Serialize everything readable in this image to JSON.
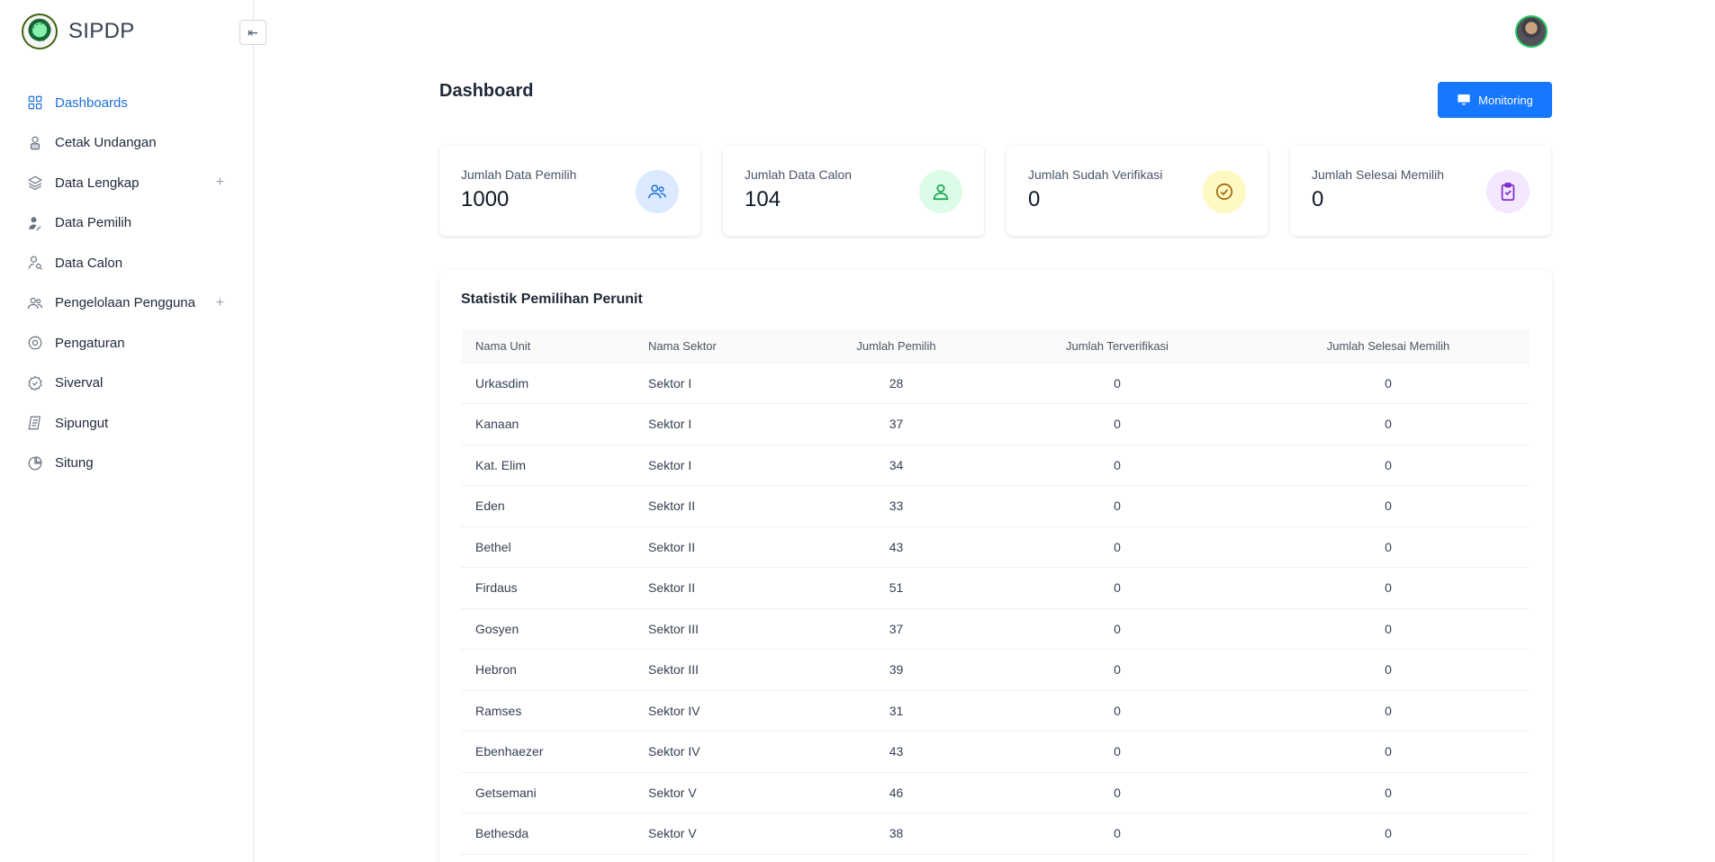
{
  "app": {
    "name": "SIPDP"
  },
  "sidebar": {
    "items": [
      {
        "label": "Dashboards",
        "icon": "grid-icon",
        "active": true,
        "expandable": false
      },
      {
        "label": "Cetak Undangan",
        "icon": "person-card-icon",
        "active": false,
        "expandable": false
      },
      {
        "label": "Data Lengkap",
        "icon": "layers-icon",
        "active": false,
        "expandable": true
      },
      {
        "label": "Data Pemilih",
        "icon": "user-edit-icon",
        "active": false,
        "expandable": false
      },
      {
        "label": "Data Calon",
        "icon": "user-search-icon",
        "active": false,
        "expandable": false
      },
      {
        "label": "Pengelolaan Pengguna",
        "icon": "users-icon",
        "active": false,
        "expandable": true
      },
      {
        "label": "Pengaturan",
        "icon": "settings-icon",
        "active": false,
        "expandable": false
      },
      {
        "label": "Siverval",
        "icon": "check-badge-icon",
        "active": false,
        "expandable": false
      },
      {
        "label": "Sipungut",
        "icon": "scroll-icon",
        "active": false,
        "expandable": false
      },
      {
        "label": "Situng",
        "icon": "pie-chart-icon",
        "active": false,
        "expandable": false
      }
    ]
  },
  "header": {
    "title": "Dashboard",
    "monitoring_label": "Monitoring"
  },
  "cards": [
    {
      "label": "Jumlah Data Pemilih",
      "value": "1000",
      "icon": "users-icon",
      "bg": "#dbeafe",
      "fg": "#1e6fd9"
    },
    {
      "label": "Jumlah Data Calon",
      "value": "104",
      "icon": "user-icon",
      "bg": "#dcfce7",
      "fg": "#16a34a"
    },
    {
      "label": "Jumlah Sudah Verifikasi",
      "value": "0",
      "icon": "check-circle-icon",
      "bg": "#fef9c3",
      "fg": "#a16207"
    },
    {
      "label": "Jumlah Selesai Memilih",
      "value": "0",
      "icon": "clipboard-check-icon",
      "bg": "#f3e8ff",
      "fg": "#7e22ce"
    }
  ],
  "stats": {
    "title": "Statistik Pemilihan Perunit",
    "columns": [
      "Nama Unit",
      "Nama Sektor",
      "Jumlah Pemilih",
      "Jumlah Terverifikasi",
      "Jumlah Selesai Memilih"
    ],
    "rows": [
      [
        "Urkasdim",
        "Sektor I",
        "28",
        "0",
        "0"
      ],
      [
        "Kanaan",
        "Sektor I",
        "37",
        "0",
        "0"
      ],
      [
        "Kat. Elim",
        "Sektor I",
        "34",
        "0",
        "0"
      ],
      [
        "Eden",
        "Sektor II",
        "33",
        "0",
        "0"
      ],
      [
        "Bethel",
        "Sektor II",
        "43",
        "0",
        "0"
      ],
      [
        "Firdaus",
        "Sektor II",
        "51",
        "0",
        "0"
      ],
      [
        "Gosyen",
        "Sektor III",
        "37",
        "0",
        "0"
      ],
      [
        "Hebron",
        "Sektor III",
        "39",
        "0",
        "0"
      ],
      [
        "Ramses",
        "Sektor IV",
        "31",
        "0",
        "0"
      ],
      [
        "Ebenhaezer",
        "Sektor IV",
        "43",
        "0",
        "0"
      ],
      [
        "Getsemani",
        "Sektor V",
        "46",
        "0",
        "0"
      ],
      [
        "Bethesda",
        "Sektor V",
        "38",
        "0",
        "0"
      ]
    ]
  }
}
